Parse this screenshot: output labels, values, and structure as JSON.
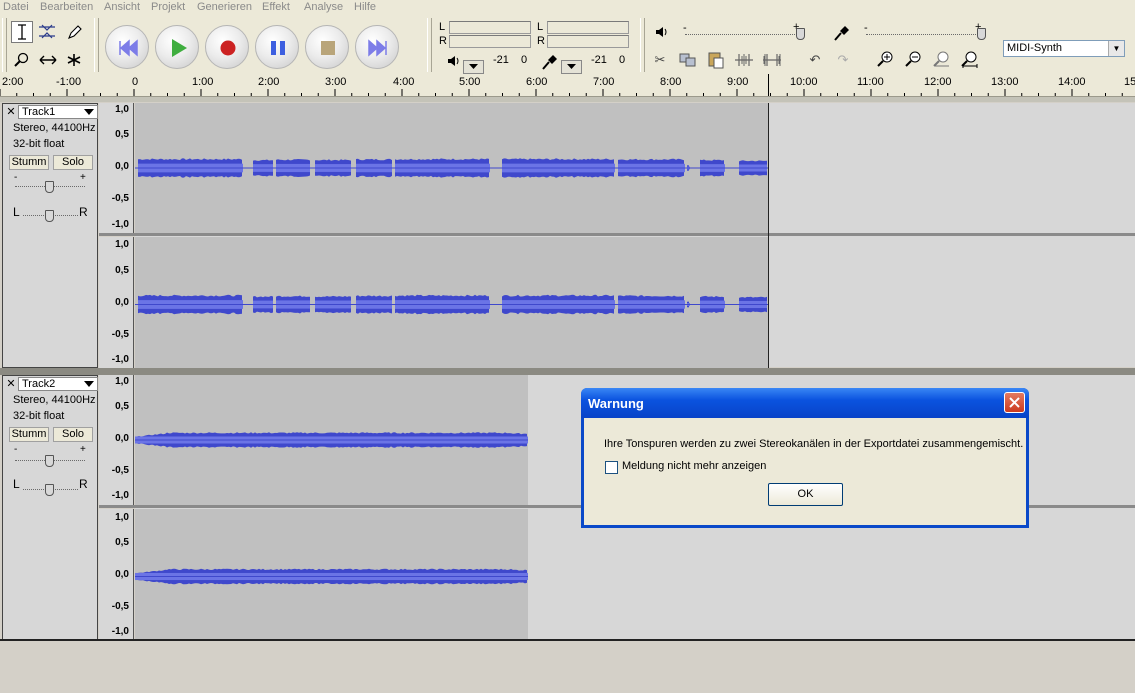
{
  "menu": [
    "Datei",
    "Bearbeiten",
    "Ansicht",
    "Projekt",
    "Generieren",
    "Effekt",
    "Analyse",
    "Hilfe"
  ],
  "meters": {
    "play_L": "L",
    "play_R": "R",
    "rec_L": "L",
    "rec_R": "R",
    "play_db1": "-21",
    "play_db2": "0",
    "rec_db1": "-21",
    "rec_db2": "0"
  },
  "volume_sliders": {
    "minus": "-",
    "plus": "+"
  },
  "midi_device": "MIDI-Synth",
  "ruler": [
    "2:00",
    "-1:00",
    "0",
    "1:00",
    "2:00",
    "3:00",
    "4:00",
    "5:00",
    "6:00",
    "7:00",
    "8:00",
    "9:00",
    "10:00",
    "11:00",
    "12:00",
    "13:00",
    "14:00",
    "15"
  ],
  "tracks": [
    {
      "name": "Track1",
      "format": "Stereo, 44100Hz",
      "bitdepth": "32-bit float",
      "mute": "Stumm",
      "solo": "Solo",
      "gain_minus": "-",
      "gain_plus": "+",
      "pan_L": "L",
      "pan_R": "R"
    },
    {
      "name": "Track2",
      "format": "Stereo, 44100Hz",
      "bitdepth": "32-bit float",
      "mute": "Stumm",
      "solo": "Solo",
      "gain_minus": "-",
      "gain_plus": "+",
      "pan_L": "L",
      "pan_R": "R"
    }
  ],
  "scale_labels": [
    "1,0",
    "0,5",
    "0,0",
    "-0,5",
    "-1,0"
  ],
  "dialog": {
    "title": "Warnung",
    "message": "Ihre Tonspuren werden zu zwei Stereokanälen in der Exportdatei zusammengemischt.",
    "checkbox_label": "Meldung nicht mehr anzeigen",
    "checkbox_checked": false,
    "ok_label": "OK"
  },
  "colors": {
    "waveform": "#3f48cc",
    "waveform_light": "#6b74e6",
    "selection": "#c0c0c0",
    "dialog_title": "#0b53df"
  },
  "icons": [
    "selection-tool-icon",
    "envelope-tool-icon",
    "draw-tool-icon",
    "zoom-tool-icon",
    "timeshift-tool-icon",
    "multi-tool-icon",
    "skip-start-icon",
    "play-icon",
    "record-icon",
    "pause-icon",
    "stop-icon",
    "skip-end-icon",
    "speaker-icon",
    "microphone-icon",
    "cut-icon",
    "copy-icon",
    "paste-icon",
    "trim-icon",
    "silence-icon",
    "undo-icon",
    "redo-icon",
    "zoom-in-icon",
    "zoom-out-icon",
    "fit-selection-icon",
    "fit-project-icon"
  ]
}
